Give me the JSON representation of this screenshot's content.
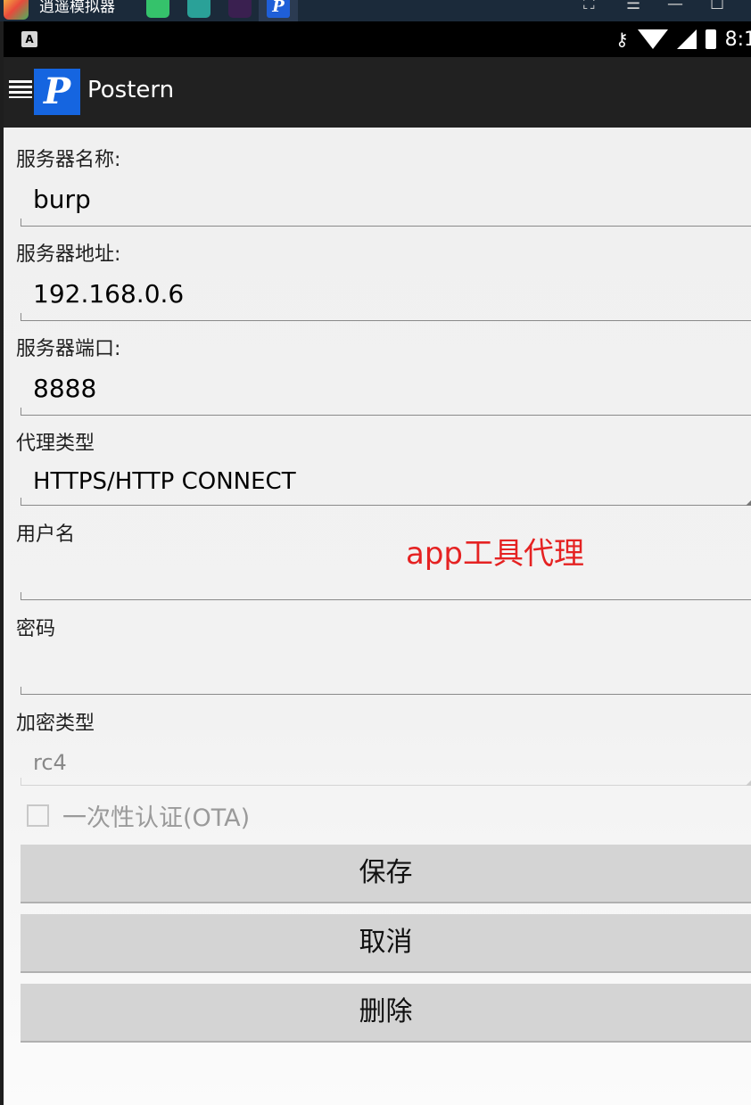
{
  "emulator": {
    "title": "逍遥模拟器",
    "controls": [
      "⛶",
      "☰",
      "—",
      "☐"
    ]
  },
  "status_bar": {
    "notification_letter": "A",
    "time": "8:1"
  },
  "toolbar": {
    "app_logo_letter": "P",
    "title": "Postern"
  },
  "form": {
    "server_name": {
      "label": "服务器名称:",
      "value": "burp"
    },
    "server_address": {
      "label": "服务器地址:",
      "value": "192.168.0.6"
    },
    "server_port": {
      "label": "服务器端口:",
      "value": "8888"
    },
    "proxy_type": {
      "label": "代理类型",
      "value": "HTTPS/HTTP CONNECT"
    },
    "username": {
      "label": "用户名",
      "value": ""
    },
    "password": {
      "label": "密码",
      "value": ""
    },
    "encryption_type": {
      "label": "加密类型",
      "value": "rc4"
    },
    "ota": {
      "label": "一次性认证(OTA)",
      "checked": false
    }
  },
  "annotation": "app工具代理",
  "buttons": {
    "save": "保存",
    "cancel": "取消",
    "delete": "删除"
  },
  "colors": {
    "toolbar": "#212121",
    "annotation": "#e52222",
    "app_logo": "#1565e0",
    "button": "#d4d4d4"
  }
}
